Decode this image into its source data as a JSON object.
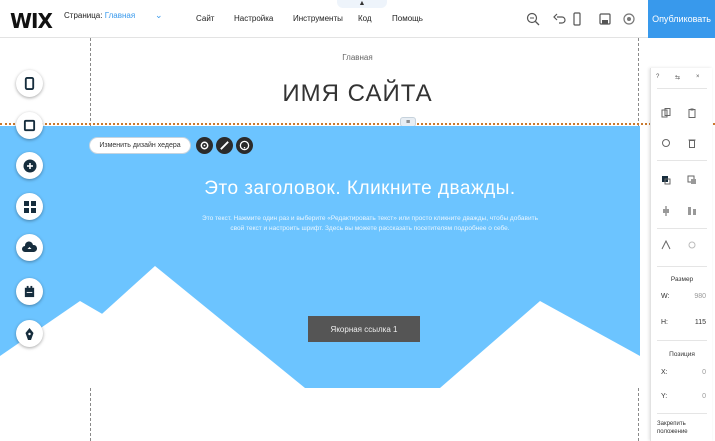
{
  "topbar": {
    "logo": "WIX",
    "page_label": "Страница:",
    "page_name": "Главная",
    "menu": [
      "Сайт",
      "Настройка",
      "Инструменты",
      "Код",
      "Помощь"
    ],
    "publish_label": "Опубликовать",
    "top_caret": "▲"
  },
  "canvas": {
    "page_label": "Главная",
    "site_name": "ИМЯ САЙТА",
    "header_handle": "≡",
    "change_header_label": "Изменить дизайн хедера",
    "heading": "Это заголовок. Кликните дважды.",
    "body_text": "Это текст. Нажмите один раз и выберите «Редактировать текст» или просто кликните дважды, чтобы добавить свой текст и настроить шрифт. Здесь вы можете рассказать посетителям подробнее о себе.",
    "anchor_button": "Якорная ссылка 1",
    "strip_color": "#6cc4ff"
  },
  "left_toolbar": [
    "pages-icon",
    "background-icon",
    "add-icon",
    "apps-icon",
    "upload-icon",
    "blog-icon",
    "pen-icon"
  ],
  "right_panel": {
    "top_icons": [
      "?",
      "⇆",
      "×"
    ],
    "size_label": "Размер",
    "w_key": "W:",
    "w_val": "980",
    "h_key": "H:",
    "h_val": "115",
    "position_label": "Позиция",
    "x_key": "X:",
    "x_val": "0",
    "y_key": "Y:",
    "y_val": "0",
    "lock_label": "Закрепить положение"
  },
  "colors": {
    "accent": "#3899ec",
    "strip": "#6cc4ff",
    "button": "#555555"
  }
}
